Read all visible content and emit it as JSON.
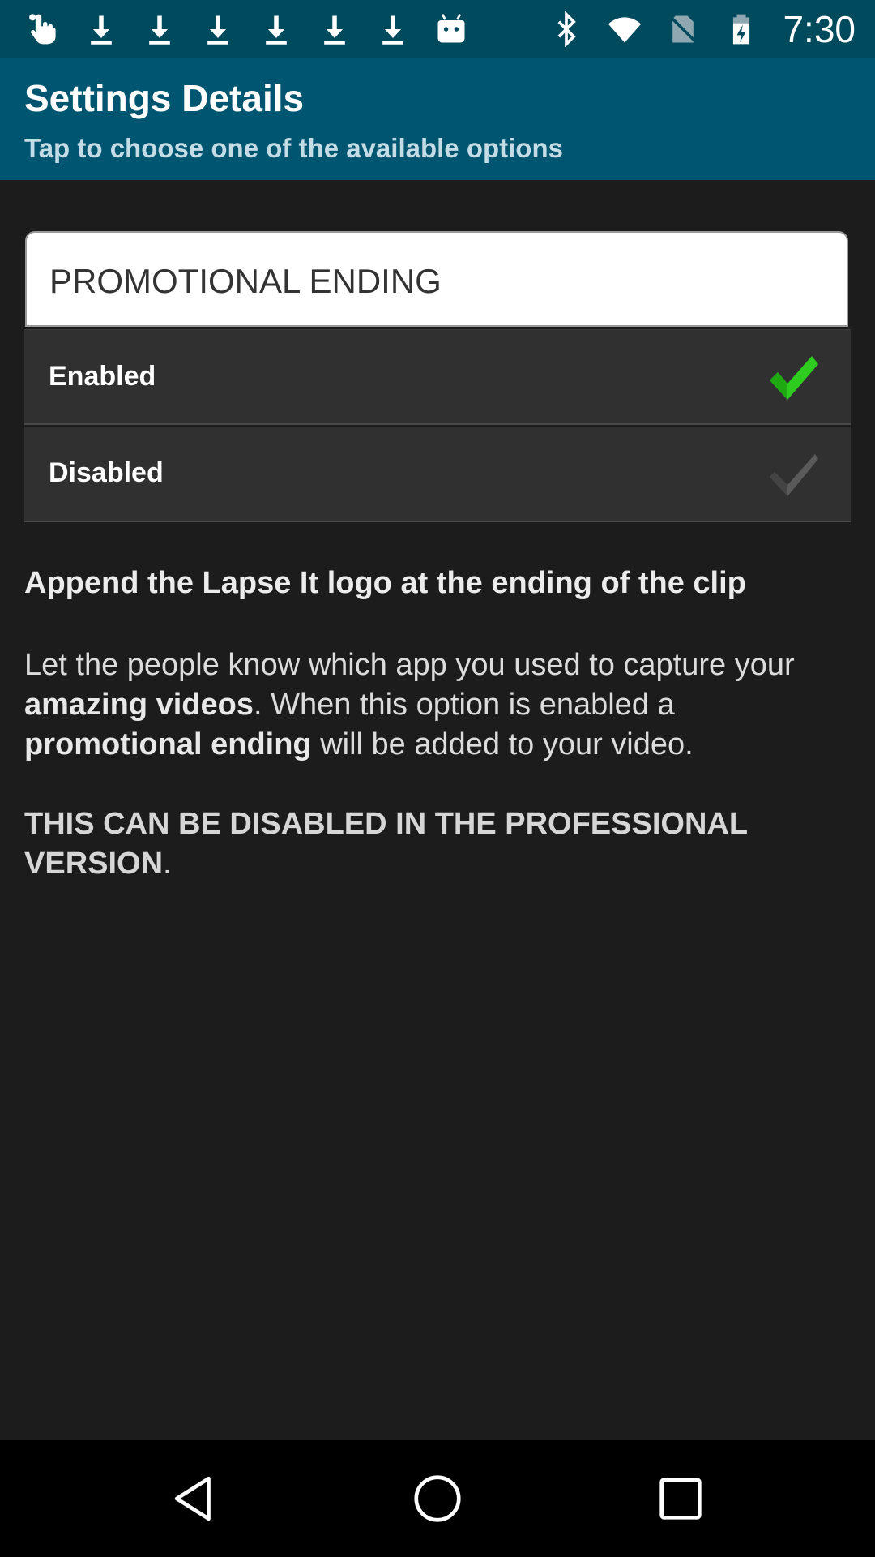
{
  "status_bar": {
    "left_icons": [
      "touch-icon",
      "download-icon",
      "download-icon",
      "download-icon",
      "download-icon",
      "download-icon",
      "download-icon",
      "android-icon"
    ],
    "right_icons": [
      "bluetooth-icon",
      "wifi-icon",
      "no-sim-icon",
      "battery-charging-icon"
    ],
    "time": "7:30",
    "color": "#004a5e"
  },
  "header": {
    "title": "Settings Details",
    "subtitle": "Tap to choose one of the available options",
    "color": "#005670"
  },
  "setting": {
    "name": "PROMOTIONAL ENDING",
    "options": [
      {
        "label": "Enabled",
        "selected": true
      },
      {
        "label": "Disabled",
        "selected": false
      }
    ],
    "check_color_selected": "#2ecc1f",
    "check_color_unselected": "#5a5a5a"
  },
  "description": {
    "heading": "Append the Lapse It logo at the ending of the clip",
    "body_1": "Let the people know which app you used to capture your ",
    "body_bold_1": "amazing videos",
    "body_2": ". When this option is enabled a ",
    "body_bold_2": "promotional ending",
    "body_3": " will be added to your video.",
    "note": "THIS CAN BE DISABLED IN THE PROFESSIONAL VERSION",
    "note_end": "."
  },
  "nav_bar": {
    "buttons": [
      "back-icon",
      "home-icon",
      "recents-icon"
    ]
  }
}
